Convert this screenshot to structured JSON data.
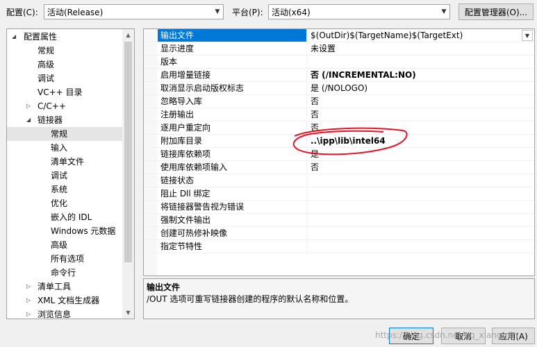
{
  "toolbar": {
    "config_label": "配置(C):",
    "config_value": "活动(Release)",
    "platform_label": "平台(P):",
    "platform_value": "活动(x64)",
    "config_manager_button": "配置管理器(O)..."
  },
  "tree": {
    "root": "配置属性",
    "items": [
      {
        "label": "常规"
      },
      {
        "label": "高级"
      },
      {
        "label": "调试"
      },
      {
        "label": "VC++ 目录"
      },
      {
        "label": "C/C++"
      },
      {
        "label": "链接器"
      },
      {
        "label": "常规"
      },
      {
        "label": "输入"
      },
      {
        "label": "清单文件"
      },
      {
        "label": "调试"
      },
      {
        "label": "系统"
      },
      {
        "label": "优化"
      },
      {
        "label": "嵌入的 IDL"
      },
      {
        "label": "Windows 元数据"
      },
      {
        "label": "高级"
      },
      {
        "label": "所有选项"
      },
      {
        "label": "命令行"
      },
      {
        "label": "清单工具"
      },
      {
        "label": "XML 文档生成器"
      },
      {
        "label": "浏览信息"
      }
    ]
  },
  "properties": [
    {
      "name": "输出文件",
      "value": "$(OutDir)$(TargetName)$(TargetExt)"
    },
    {
      "name": "显示进度",
      "value": "未设置"
    },
    {
      "name": "版本",
      "value": ""
    },
    {
      "name": "启用增量链接",
      "value": "否 (/INCREMENTAL:NO)"
    },
    {
      "name": "取消显示启动版权标志",
      "value": "是 (/NOLOGO)"
    },
    {
      "name": "忽略导入库",
      "value": "否"
    },
    {
      "name": "注册输出",
      "value": "否"
    },
    {
      "name": "逐用户重定向",
      "value": "否"
    },
    {
      "name": "附加库目录",
      "value": "..\\ipp\\lib\\intel64"
    },
    {
      "name": "链接库依赖项",
      "value": "是"
    },
    {
      "name": "使用库依赖项输入",
      "value": "否"
    },
    {
      "name": "链接状态",
      "value": ""
    },
    {
      "name": "阻止 Dll 绑定",
      "value": ""
    },
    {
      "name": "将链接器警告视为错误",
      "value": ""
    },
    {
      "name": "强制文件输出",
      "value": ""
    },
    {
      "name": "创建可热修补映像",
      "value": ""
    },
    {
      "name": "指定节特性",
      "value": ""
    }
  ],
  "description": {
    "title": "输出文件",
    "body": "/OUT 选项可重写链接器创建的程序的默认名称和位置。"
  },
  "buttons": {
    "ok": "确定",
    "cancel": "取消",
    "apply": "应用(A)"
  },
  "watermark": "https://blog.csdn.net/qq_xiangmin"
}
